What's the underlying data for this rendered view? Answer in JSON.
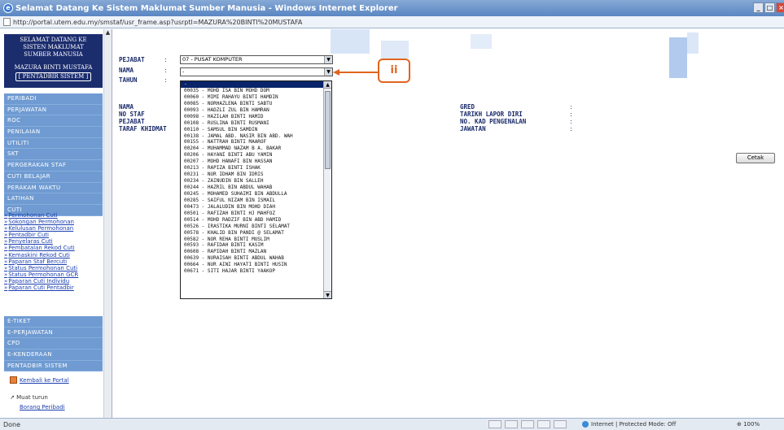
{
  "window": {
    "title": "Selamat Datang Ke Sistem Maklumat Sumber Manusia - Windows Internet Explorer",
    "url": "http://portal.utem.edu.my/smstaf/usr_frame.asp?usrptl=MAZURA%20BINTI%20MUSTAFA"
  },
  "sidebar": {
    "header_lines": [
      "SELAMAT DATANG KE",
      "SISTEN MAKLUMAT",
      "SUMBER MANUSIA",
      "MAZURA BINTI MUSTAFA",
      "[ PENTADBIR SISTEM ]"
    ],
    "menu_top": [
      "PERIBADI",
      "PERJAWATAN",
      "ROC",
      "PENILAIAN",
      "UTILITI",
      "SKT",
      "PERGERAKAN STAF",
      "CUTI BELAJAR",
      "PERAKAM WAKTU",
      "LATIHAN",
      "CUTI"
    ],
    "cuti_links": [
      "Permohonan Cuti",
      "Sokongan Permohonan",
      "Kelulusan Permohonan",
      "Pentadbir Cuti",
      "Penyelaras Cuti",
      "Pembatalan Rekod Cuti",
      "Kemaskini Rekod Cuti",
      "Paparan Staf Bercuti",
      "Status Permohonan Cuti",
      "Status Permohonan GCR",
      "Paparan Cuti Individu",
      "Paparan Cuti Pentadbir"
    ],
    "menu_bottom": [
      "E-TIKET",
      "E-PERJAWATAN",
      "CPD",
      "E-KENDERAAN",
      "PENTADBIR SISTEM"
    ],
    "kembali": "Kembali ke Portal",
    "muat_turun": "Muat turun",
    "borang": "Borang Peribadi"
  },
  "form": {
    "pejabat_label": "PEJABAT",
    "pejabat_value": "07 - PUSAT KOMPUTER",
    "nama_label": "NAMA",
    "nama_value": "-",
    "tahun_label": "TAHUN",
    "colon": ":"
  },
  "dropdown_options": [
    "-",
    "00035 - MOHD ISA BIN MOHD DOM",
    "00060 - MIMI RAHAYU BINTI HAMDIN",
    "00085 - NORHAZLENA BINTI SABTU",
    "00093 - HADZLI ZUL BIN HAMRAN",
    "00098 - HAZILAH BINTI HAMID",
    "00108 - RUSLINA BINTI RUSMANI",
    "00110 - SAMSUL BIN SAMDIN",
    "00138 - JAMAL ABD. NASIR BIN ABD. WAH",
    "00155 - NATTRAH BINTI MAAROF",
    "00204 - MUHAMMAD NAZAM B A. BAKAR",
    "00206 - HAYANI BINTI ABU YAMIN",
    "00207 - MOHD HANAFI BIN HASSAN",
    "00213 - RAPIZA BINTI ISHAK",
    "00231 - NUR IDHAM BIN IDRIS",
    "00234 - ZAINUDIN BIN SALLEH",
    "00244 - HAZRIL BIN ABDUL WAHAB",
    "00245 - MOHAMED SUHAIMI BIN ABDULLA",
    "00285 - SAIFUL NIZAM BIN ISMAIL",
    "00473 - JALALUDIN BIN MOHD DIAH",
    "00501 - RAFIZAH BINTI HJ MAHFOZ",
    "00514 - MOHD RADZIF BIN ABD HAMID",
    "00526 - IRASTIKA MURNI BINTI SELAMAT",
    "00578 - KHALID BIN PANDI @ SELAMAT",
    "00582 - NOR REHA BINTI MUSLIM",
    "00593 - RAFIDAH BINTI KASIM",
    "00608 - RAPIDAH BINTI MAZLAN",
    "00639 - NURAISAH BINTI ABDUL WAHAB",
    "00664 - NUR AINI HAYATI BINTI HUSIN",
    "00671 - SITI HAJAR BINTI YAAKOP"
  ],
  "info_left": [
    "NAMA",
    "NO STAF",
    "PEJABAT",
    "TARAF KHIDMAT"
  ],
  "info_right": [
    "GRED",
    "TARIKH LAPOR DIRI",
    "NO. KAD PENGENALAN",
    "JAWATAN"
  ],
  "callout": "ii",
  "cetak": "Cetak",
  "status": {
    "left": "Done",
    "zone": "Internet | Protected Mode: Off",
    "zoom": "100%"
  },
  "colors": {
    "menu": "#6f9bd2",
    "header": "#1c2d6e",
    "callout": "#e0651f",
    "highlight": "#0a246a"
  }
}
